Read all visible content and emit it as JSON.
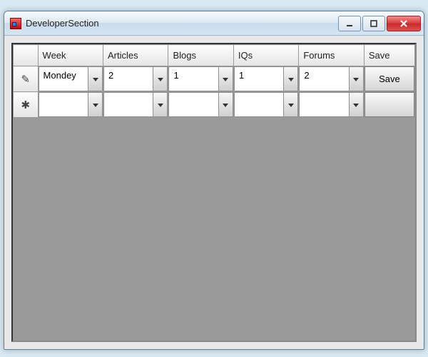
{
  "window": {
    "title": "DeveloperSection"
  },
  "grid": {
    "columns": [
      "Week",
      "Articles",
      "Blogs",
      "IQs",
      "Forums",
      "Save"
    ],
    "rows": [
      {
        "indicator": "edit",
        "week": "Mondey",
        "articles": "2",
        "blogs": "1",
        "iqs": "1",
        "forums": "2",
        "save_label": "Save"
      },
      {
        "indicator": "new",
        "week": "",
        "articles": "",
        "blogs": "",
        "iqs": "",
        "forums": "",
        "save_label": ""
      }
    ]
  },
  "icons": {
    "edit_glyph": "✎",
    "new_glyph": "✱"
  }
}
